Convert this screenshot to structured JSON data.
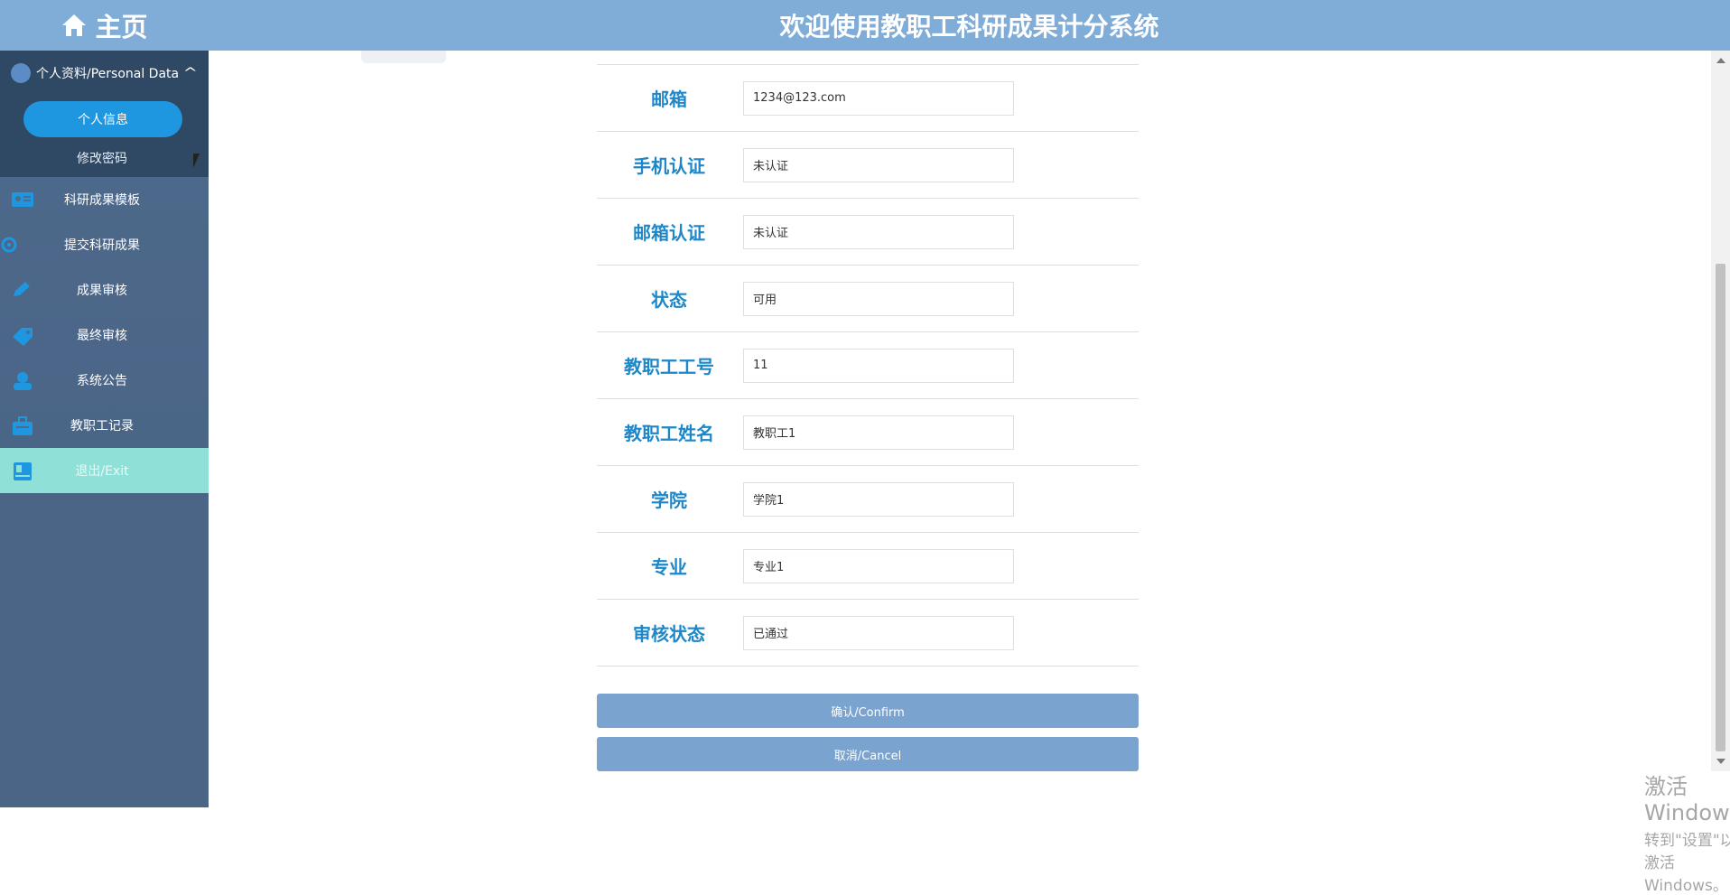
{
  "app": {
    "title": "欢迎使用教职工科研成果计分系统",
    "home_label": "主页"
  },
  "sidebar": {
    "group_label": "个人资料/Personal Data",
    "sub_items": [
      "个人信息",
      "修改密码"
    ],
    "items": [
      {
        "label": "科研成果模板",
        "icon": "id-card-icon"
      },
      {
        "label": "提交科研成果",
        "icon": "gear-icon"
      },
      {
        "label": "成果审核",
        "icon": "edit-icon"
      },
      {
        "label": "最终审核",
        "icon": "tag-icon"
      },
      {
        "label": "系统公告",
        "icon": "user-icon"
      },
      {
        "label": "教职工记录",
        "icon": "briefcase-icon"
      },
      {
        "label": "退出/Exit",
        "icon": "book-icon"
      }
    ]
  },
  "form": {
    "rows": [
      {
        "label": "邮箱",
        "value": "1234@123.com"
      },
      {
        "label": "手机认证",
        "value": "未认证"
      },
      {
        "label": "邮箱认证",
        "value": "未认证"
      },
      {
        "label": "状态",
        "value": "可用"
      },
      {
        "label": "教职工工号",
        "value": "11"
      },
      {
        "label": "教职工姓名",
        "value": "教职工1"
      },
      {
        "label": "学院",
        "value": "学院1"
      },
      {
        "label": "专业",
        "value": "专业1"
      },
      {
        "label": "审核状态",
        "value": "已通过"
      }
    ],
    "confirm_label": "确认/Confirm",
    "cancel_label": "取消/Cancel"
  },
  "watermark": {
    "line1": "激活 Windows",
    "line2": "转到\"设置\"以激活 Windows。"
  },
  "colors": {
    "accent": "#80acd8",
    "label_blue": "#1e87c8",
    "sidebar_bg": "#4e6a8c",
    "active_pill": "#1f96e0",
    "exit_highlight": "#8fe0d6",
    "button": "#7aa3d0"
  }
}
